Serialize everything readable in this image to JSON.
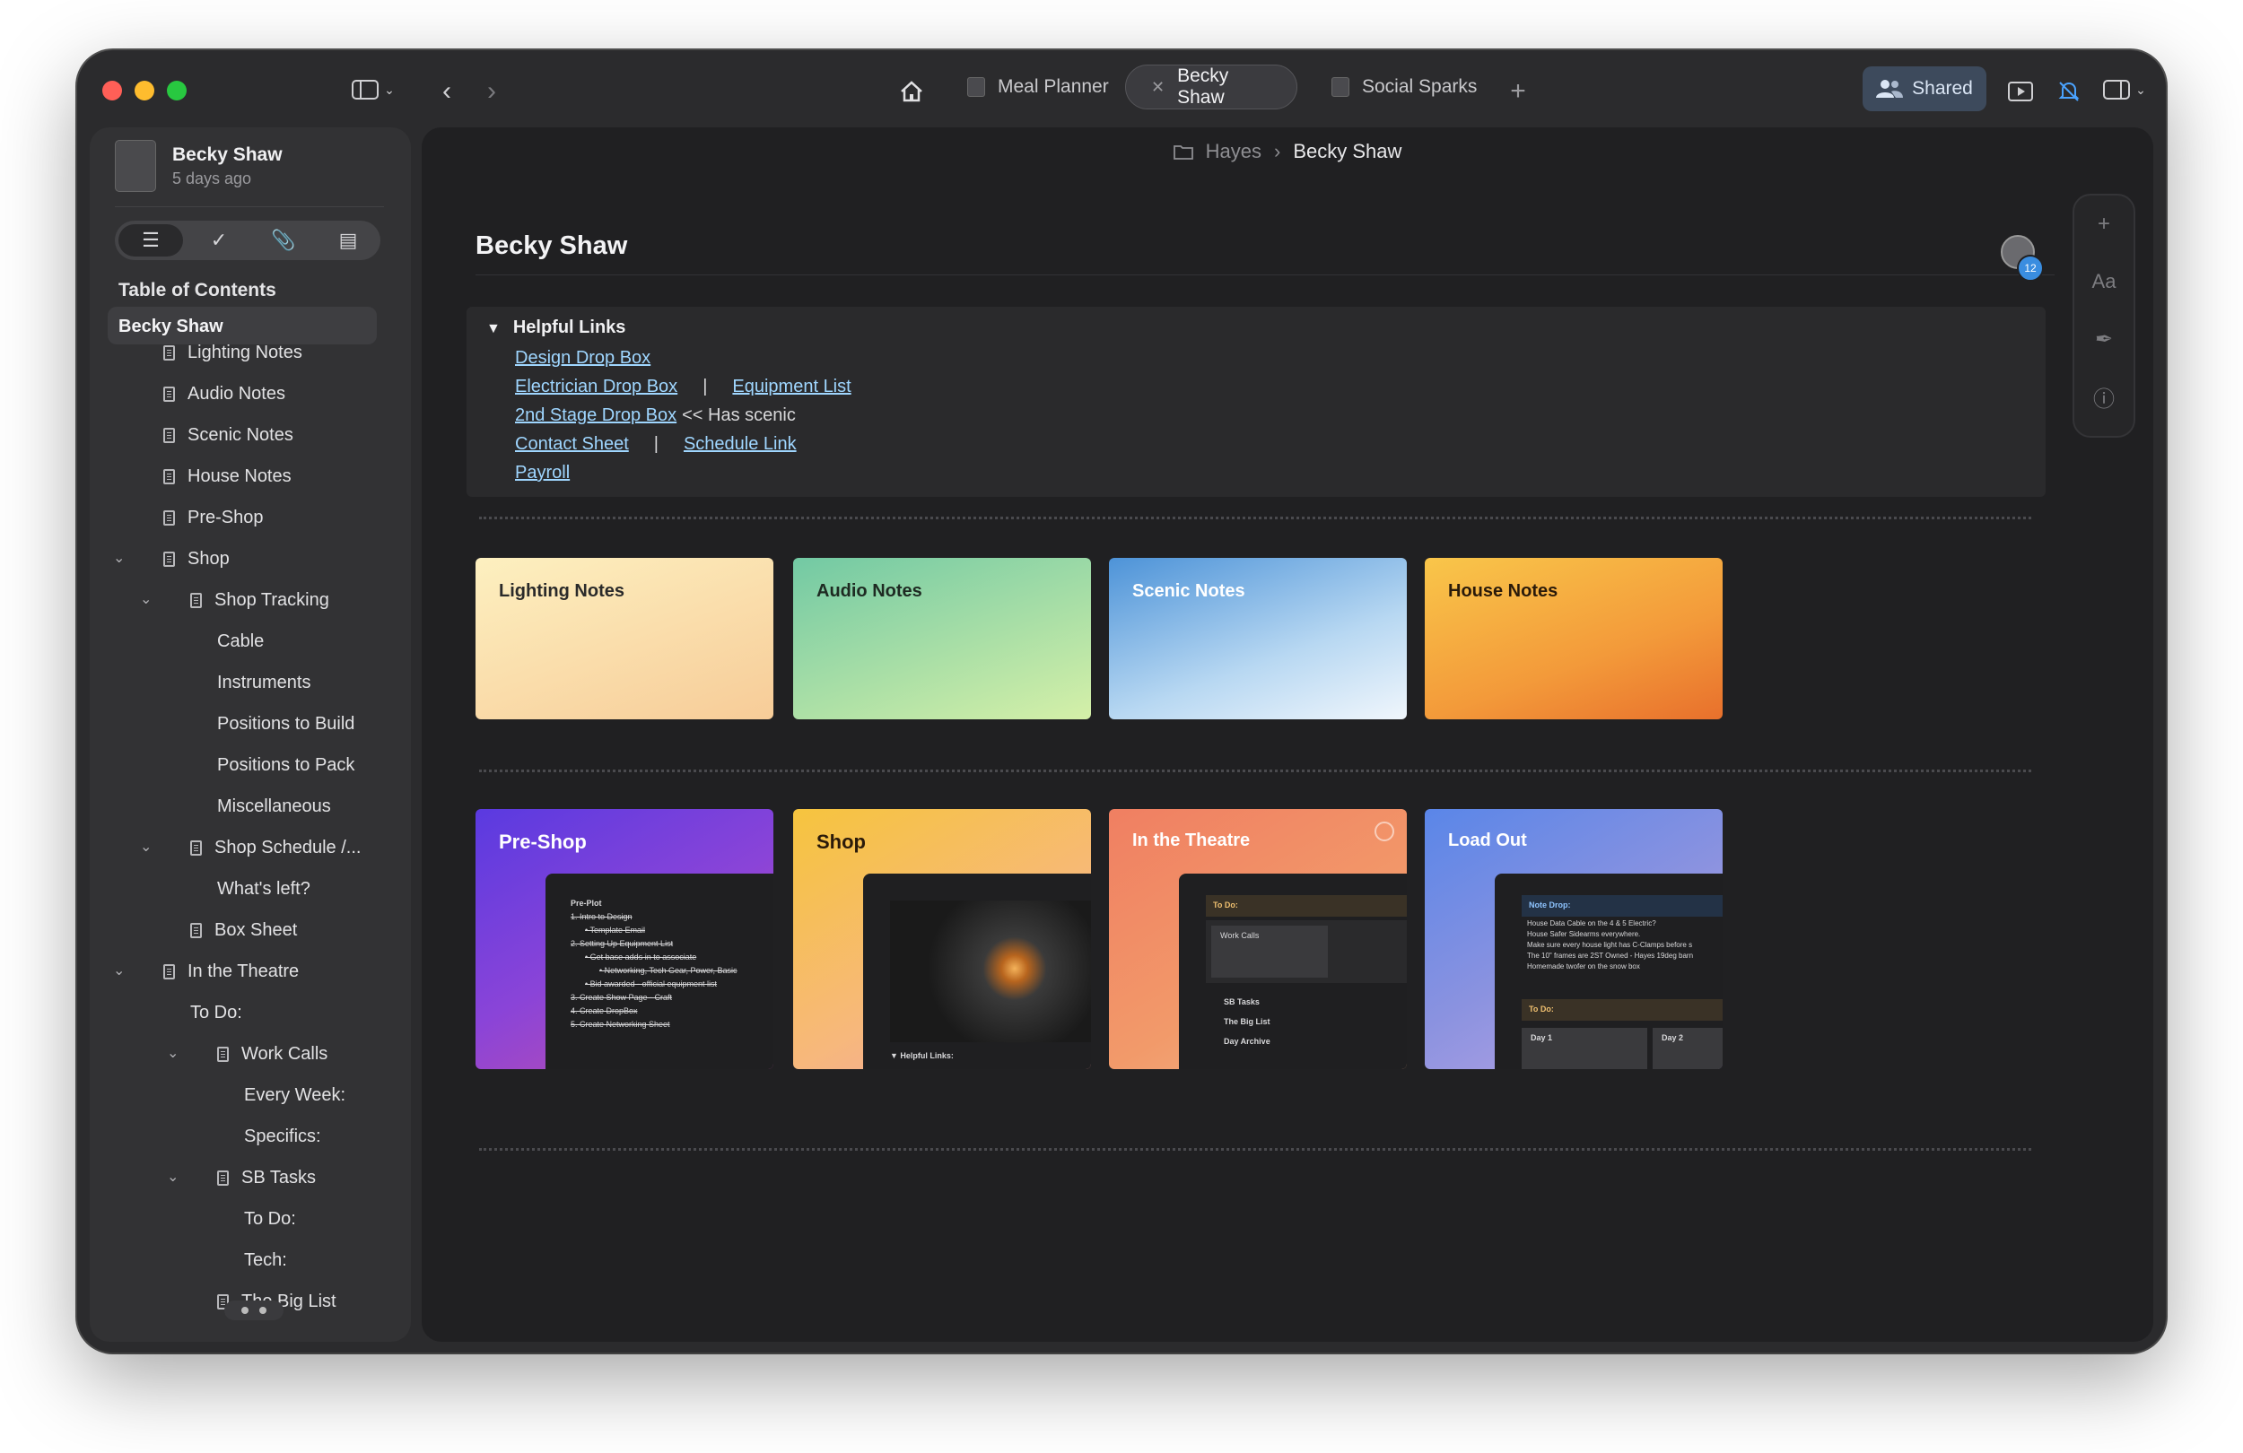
{
  "titlebar": {
    "tabs": [
      {
        "label": "Meal Planner"
      },
      {
        "label": "Becky Shaw"
      },
      {
        "label": "Social Sparks"
      }
    ],
    "shared_label": "Shared"
  },
  "sidebar": {
    "doc_title": "Becky Shaw",
    "doc_date": "5 days ago",
    "toc_heading": "Table of Contents",
    "toc": [
      {
        "label": "Becky Shaw"
      },
      {
        "label": "Lighting Notes"
      },
      {
        "label": "Audio Notes"
      },
      {
        "label": "Scenic Notes"
      },
      {
        "label": "House Notes"
      },
      {
        "label": "Pre-Shop"
      },
      {
        "label": "Shop"
      },
      {
        "label": "Shop Tracking"
      },
      {
        "label": "Cable"
      },
      {
        "label": "Instruments"
      },
      {
        "label": "Positions to Build"
      },
      {
        "label": "Positions to Pack"
      },
      {
        "label": "Miscellaneous"
      },
      {
        "label": "Shop Schedule /..."
      },
      {
        "label": "What's left?"
      },
      {
        "label": "Box Sheet"
      },
      {
        "label": "In the Theatre"
      },
      {
        "label": "To Do:"
      },
      {
        "label": "Work Calls"
      },
      {
        "label": "Every Week:"
      },
      {
        "label": "Specifics:"
      },
      {
        "label": "SB Tasks"
      },
      {
        "label": "To Do:"
      },
      {
        "label": "Tech:"
      },
      {
        "label": "The Big List"
      }
    ]
  },
  "main": {
    "breadcrumb": {
      "parent": "Hayes",
      "current": "Becky Shaw"
    },
    "page_title": "Becky Shaw",
    "avatar_count": "12",
    "helpful_links": {
      "heading": "Helpful Links",
      "design": "Design Drop Box",
      "electrician": "Electrician Drop Box",
      "sep": "|",
      "equipment": "Equipment List",
      "stage2": "2nd Stage Drop Box",
      "stage2_note": "<< Has scenic",
      "contact": "Contact Sheet",
      "schedule": "Schedule Link",
      "payroll": "Payroll"
    },
    "note_cards": [
      {
        "label": "Lighting Notes"
      },
      {
        "label": "Audio Notes"
      },
      {
        "label": "Scenic Notes"
      },
      {
        "label": "House Notes"
      }
    ],
    "phase_cards": [
      {
        "label": "Pre-Shop"
      },
      {
        "label": "Shop"
      },
      {
        "label": "In the Theatre"
      },
      {
        "label": "Load Out"
      }
    ],
    "previews": {
      "preshop_head": "Pre-Plot",
      "preshop_lines": [
        "1. Intro to Design",
        "• Template Email",
        "2. Setting Up Equipment List",
        "• Get base adds in to associate",
        "• Networking, Tech Gear, Power, Basic",
        "• Bid awarded - official equipment list",
        "3. Create Show Page - Craft",
        "4. Create DropBox",
        "5. Create Networking Sheet"
      ],
      "shop_caption": "Helpful Links:",
      "theatre_todo": "To Do:",
      "theatre_workcalls": "Work Calls",
      "theatre_lines": [
        "SB Tasks",
        "The Big List",
        "Day Archive"
      ],
      "loadout_head": "Note Drop:",
      "loadout_lines": [
        "House Data Cable on the 4 & 5 Electric?",
        "House Safer Sidearms everywhere.",
        "Make sure every house light has C-Clamps before s",
        "The 10\" frames are 2ST Owned - Hayes 19deg barn",
        "Homemade twofer on the snow box"
      ],
      "loadout_todo": "To Do:",
      "loadout_day1": "Day 1",
      "loadout_day2": "Day 2"
    }
  }
}
